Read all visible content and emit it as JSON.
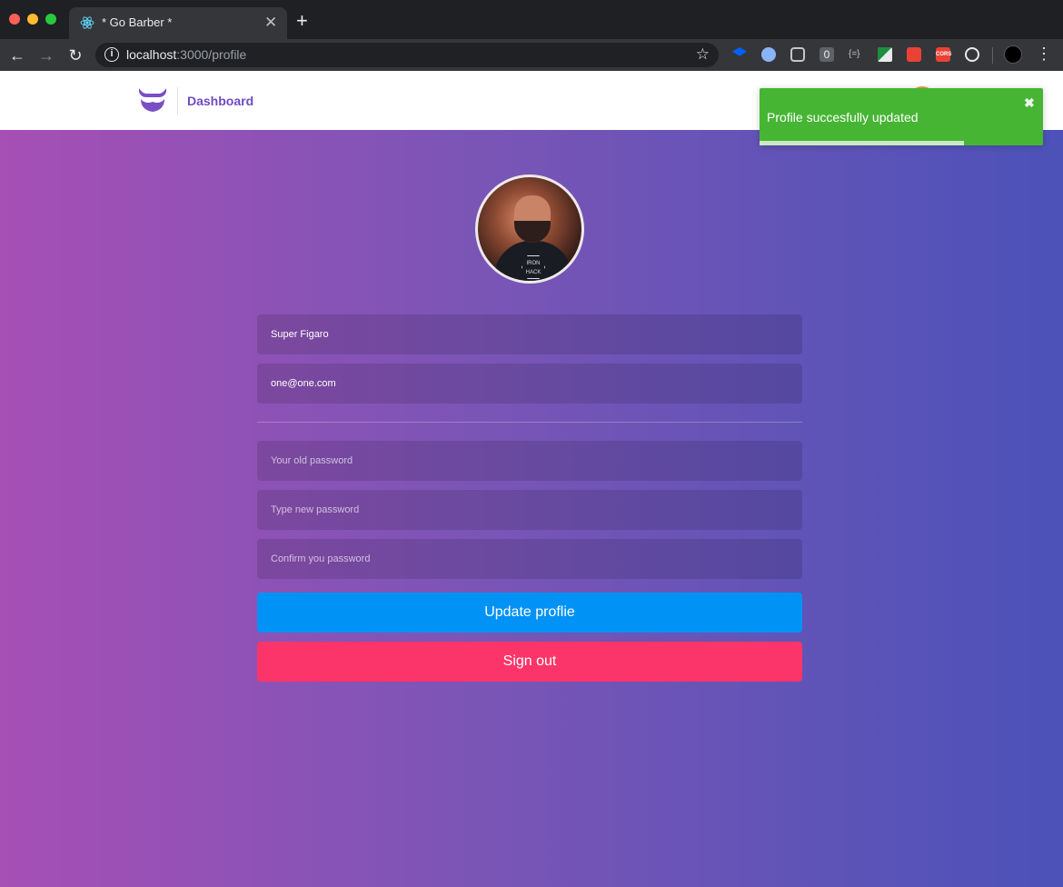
{
  "browser": {
    "tab_title": "* Go Barber *",
    "tab_close": "✕",
    "new_tab": "+",
    "url_host": "localhost",
    "url_path": ":3000/profile"
  },
  "header": {
    "nav_dashboard": "Dashboard"
  },
  "toast": {
    "message": "Profile succesfully updated",
    "close": "✖",
    "progress": 0.72,
    "color": "#47b534"
  },
  "form": {
    "name_value": "Super Figaro",
    "email_value": "one@one.com",
    "old_password_placeholder": "Your old password",
    "new_password_placeholder": "Type new password",
    "confirm_password_placeholder": "Confirm you password",
    "update_label": "Update proflie",
    "signout_label": "Sign out"
  },
  "colors": {
    "update_button": "#0192f6",
    "signout_button": "#fb3569",
    "brand": "#6c4cc4"
  },
  "avatar_hex_text": "IRON HACK"
}
